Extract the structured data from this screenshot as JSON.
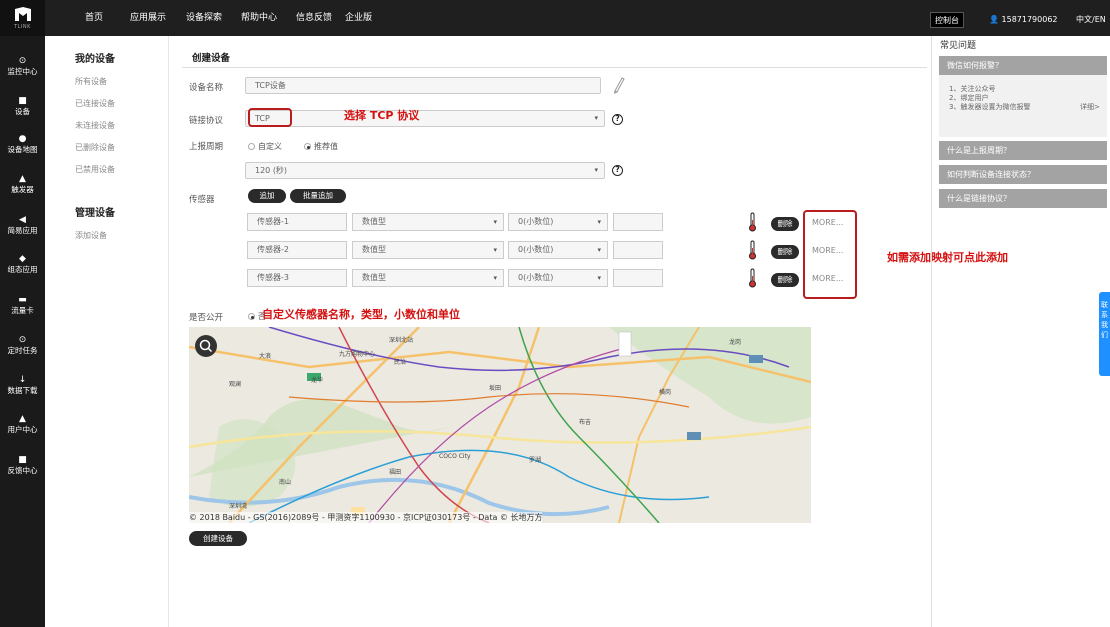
{
  "brand": {
    "logo_text": "TLINK"
  },
  "topnav": [
    "首页",
    "应用展示",
    "设备探索",
    "帮助中心",
    "信息反馈",
    "企业版"
  ],
  "topright": {
    "console": "控制台",
    "phone": "15871790062",
    "lang": "中文/EN"
  },
  "sidebar": [
    {
      "icon": "⊙",
      "label": "监控中心"
    },
    {
      "icon": "■",
      "label": "设备"
    },
    {
      "icon": "●",
      "label": "设备地图"
    },
    {
      "icon": "▲",
      "label": "触发器"
    },
    {
      "icon": "◀",
      "label": "简易应用"
    },
    {
      "icon": "◆",
      "label": "组态应用"
    },
    {
      "icon": "▬",
      "label": "流量卡"
    },
    {
      "icon": "⊙",
      "label": "定时任务"
    },
    {
      "icon": "↓",
      "label": "数据下载"
    },
    {
      "icon": "▲",
      "label": "用户中心"
    },
    {
      "icon": "■",
      "label": "反馈中心"
    }
  ],
  "subnav": {
    "my_devices": "我的设备",
    "device_items": [
      "所有设备",
      "已连接设备",
      "未连接设备",
      "已删除设备",
      "已禁用设备"
    ],
    "manage": "管理设备",
    "manage_items": [
      "添加设备"
    ]
  },
  "form": {
    "title": "创建设备",
    "name_label": "设备名称",
    "name_value": "TCP设备",
    "protocol_label": "链接协议",
    "protocol_value": "TCP",
    "period_label": "上报周期",
    "period_custom": "自定义",
    "period_recommend": "推荐值",
    "period_value": "120 (秒)",
    "sensor_label": "传感器",
    "add_btn": "追加",
    "batch_btn": "批量追加",
    "sensors": [
      {
        "name": "传感器-1",
        "type": "数值型",
        "decimal": "0(小数位)",
        "delete": "删除",
        "more": "MORE..."
      },
      {
        "name": "传感器-2",
        "type": "数值型",
        "decimal": "0(小数位)",
        "delete": "删除",
        "more": "MORE..."
      },
      {
        "name": "传感器-3",
        "type": "数值型",
        "decimal": "0(小数位)",
        "delete": "删除",
        "more": "MORE..."
      }
    ],
    "public_label": "是否公开",
    "public_option": "否",
    "submit": "创建设备"
  },
  "annotations": {
    "tcp": "选择 TCP 协议",
    "mapping": "如需添加映射可点此添加",
    "custom": "自定义传感器名称，类型，小数位和单位"
  },
  "map": {
    "copyright": "© 2018 Baidu - GS(2016)2089号 - 甲测资字1100930 - 京ICP证030173号 - Data © 长地万方",
    "labels": [
      "深圳北站",
      "九方购物中心",
      "龙华",
      "民治",
      "大浪",
      "观澜",
      "坂田",
      "布吉",
      "龙岗",
      "横岗",
      "南山",
      "福田",
      "罗湖",
      "COCO City",
      "深圳湾"
    ]
  },
  "faq": {
    "title": "常见问题",
    "q1": "微信如何报警？",
    "q1_steps": [
      "1、关注公众号",
      "2、绑定用户",
      "3、触发器设置为微信报警"
    ],
    "q1_more": "详细>",
    "q2": "什么是上报周期？",
    "q3": "如何判断设备连接状态？",
    "q4": "什么是链接协议？"
  },
  "side_tab": "联系我们"
}
